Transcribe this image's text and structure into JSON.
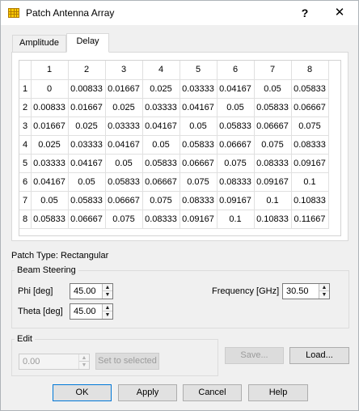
{
  "window": {
    "title": "Patch Antenna Array",
    "help_label": "?",
    "close_label": "✕"
  },
  "tabs": [
    {
      "label": "Amplitude",
      "selected": false
    },
    {
      "label": "Delay",
      "selected": true
    }
  ],
  "delay_table": {
    "column_headers": [
      "1",
      "2",
      "3",
      "4",
      "5",
      "6",
      "7",
      "8"
    ],
    "row_headers": [
      "1",
      "2",
      "3",
      "4",
      "5",
      "6",
      "7",
      "8"
    ],
    "rows": [
      [
        "0",
        "0.00833",
        "0.01667",
        "0.025",
        "0.03333",
        "0.04167",
        "0.05",
        "0.05833"
      ],
      [
        "0.00833",
        "0.01667",
        "0.025",
        "0.03333",
        "0.04167",
        "0.05",
        "0.05833",
        "0.06667"
      ],
      [
        "0.01667",
        "0.025",
        "0.03333",
        "0.04167",
        "0.05",
        "0.05833",
        "0.06667",
        "0.075"
      ],
      [
        "0.025",
        "0.03333",
        "0.04167",
        "0.05",
        "0.05833",
        "0.06667",
        "0.075",
        "0.08333"
      ],
      [
        "0.03333",
        "0.04167",
        "0.05",
        "0.05833",
        "0.06667",
        "0.075",
        "0.08333",
        "0.09167"
      ],
      [
        "0.04167",
        "0.05",
        "0.05833",
        "0.06667",
        "0.075",
        "0.08333",
        "0.09167",
        "0.1"
      ],
      [
        "0.05",
        "0.05833",
        "0.06667",
        "0.075",
        "0.08333",
        "0.09167",
        "0.1",
        "0.10833"
      ],
      [
        "0.05833",
        "0.06667",
        "0.075",
        "0.08333",
        "0.09167",
        "0.1",
        "0.10833",
        "0.11667"
      ]
    ]
  },
  "patch_type": "Patch Type: Rectangular",
  "beam_steering": {
    "group_label": "Beam Steering",
    "phi_label": "Phi [deg]",
    "phi_value": "45.00",
    "theta_label": "Theta [deg]",
    "theta_value": "45.00",
    "frequency_label": "Frequency [GHz]",
    "frequency_value": "30.50"
  },
  "edit": {
    "group_label": "Edit",
    "value": "0.00",
    "set_selected_label": "Set to selected"
  },
  "buttons": {
    "save": "Save...",
    "load": "Load...",
    "ok": "OK",
    "apply": "Apply",
    "cancel": "Cancel",
    "help": "Help"
  },
  "icons": {
    "app": "patch-array-icon",
    "spin_up": "▲",
    "spin_down": "▼"
  },
  "colors": {
    "accent": "#0078d7",
    "window_bg": "#f0f0f0",
    "icon_fill": "#ffcc00"
  }
}
